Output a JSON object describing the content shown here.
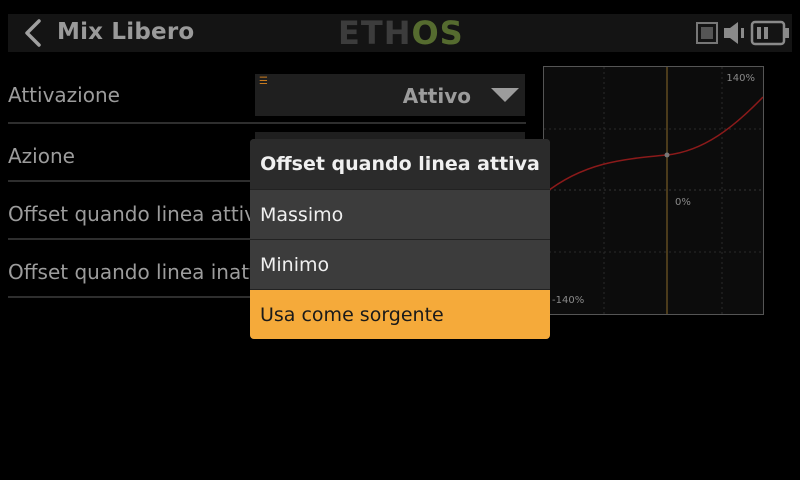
{
  "header": {
    "title": "Mix Libero",
    "brand_a": "ETH",
    "brand_b": "OS"
  },
  "settings": {
    "rows": [
      {
        "label": "Attivazione",
        "value": "Attivo"
      },
      {
        "label": "Azione",
        "value": ""
      },
      {
        "label": "Offset quando linea attiva",
        "value": ""
      },
      {
        "label": "Offset quando linea inattiva",
        "value": ""
      }
    ]
  },
  "graph": {
    "top_label": "140%",
    "mid_label": "0%",
    "bottom_label": "-140%",
    "curve_color": "#8b1a1a",
    "center_line_color": "#8a6a2a"
  },
  "popup": {
    "title": "Offset quando linea attiva",
    "options": [
      "Massimo",
      "Minimo",
      "Usa come sorgente"
    ],
    "selected": "Usa come sorgente",
    "highlight_color": "#f5aa3a"
  },
  "icons": {
    "back": "chevron-left-icon",
    "record": "record-icon",
    "speaker": "speaker-icon",
    "battery": "battery-icon",
    "dropdown": "dropdown-caret-icon",
    "menu": "menu-icon"
  }
}
